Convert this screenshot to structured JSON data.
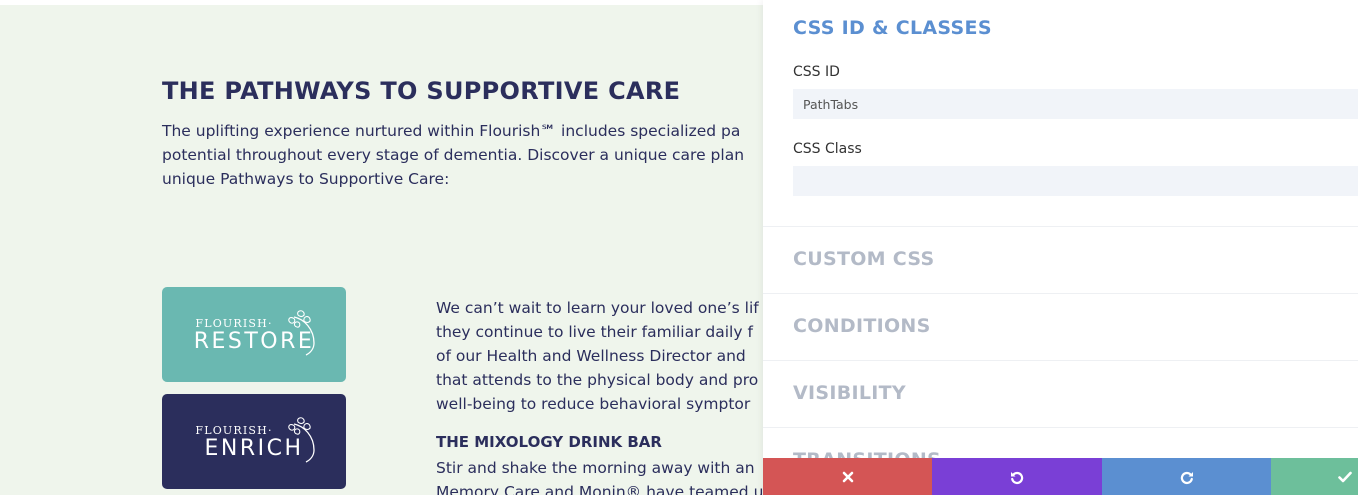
{
  "page": {
    "title": "THE PATHWAYS TO SUPPORTIVE CARE",
    "intro_lines": [
      "The uplifting experience nurtured within Flourish℠ includes specialized pa",
      "potential throughout every stage of dementia. Discover a unique care plan",
      "unique Pathways to Supportive Care:"
    ],
    "logos": {
      "restore": {
        "small": "FLOURISH·",
        "big": "RESTORE"
      },
      "enrich": {
        "small": "FLOURISH·",
        "big": "ENRICH"
      }
    },
    "body_lines": [
      "We can’t wait to learn your loved one’s lif",
      "they continue to live their familiar daily f",
      "of our Health and Wellness Director and",
      "that attends to the physical body and pro",
      "well-being to reduce behavioral symptor"
    ],
    "subhead": "THE MIXOLOGY DRINK BAR",
    "body2_lines": [
      "Stir and shake the morning away with an",
      "Memory Care and Monin® have teamed u"
    ],
    "colors": {
      "navy": "#2b2e5c",
      "teal": "#6ab8b1",
      "background": "#eff5ec"
    }
  },
  "panel": {
    "section_title": "CSS ID & CLASSES",
    "css_id_label": "CSS ID",
    "css_id_value": "PathTabs",
    "css_class_label": "CSS Class",
    "css_class_value": "",
    "collapsed_sections": [
      "CUSTOM CSS",
      "CONDITIONS",
      "VISIBILITY",
      "TRANSITIONS"
    ],
    "actions": {
      "discard_icon": "close-icon",
      "undo_icon": "undo-icon",
      "redo_icon": "redo-icon",
      "save_icon": "check-icon"
    },
    "colors": {
      "accent": "#5b8fd1",
      "discard": "#d45555",
      "undo": "#7a3fd6",
      "redo": "#5b8fd1",
      "save": "#6dbf9b"
    }
  }
}
